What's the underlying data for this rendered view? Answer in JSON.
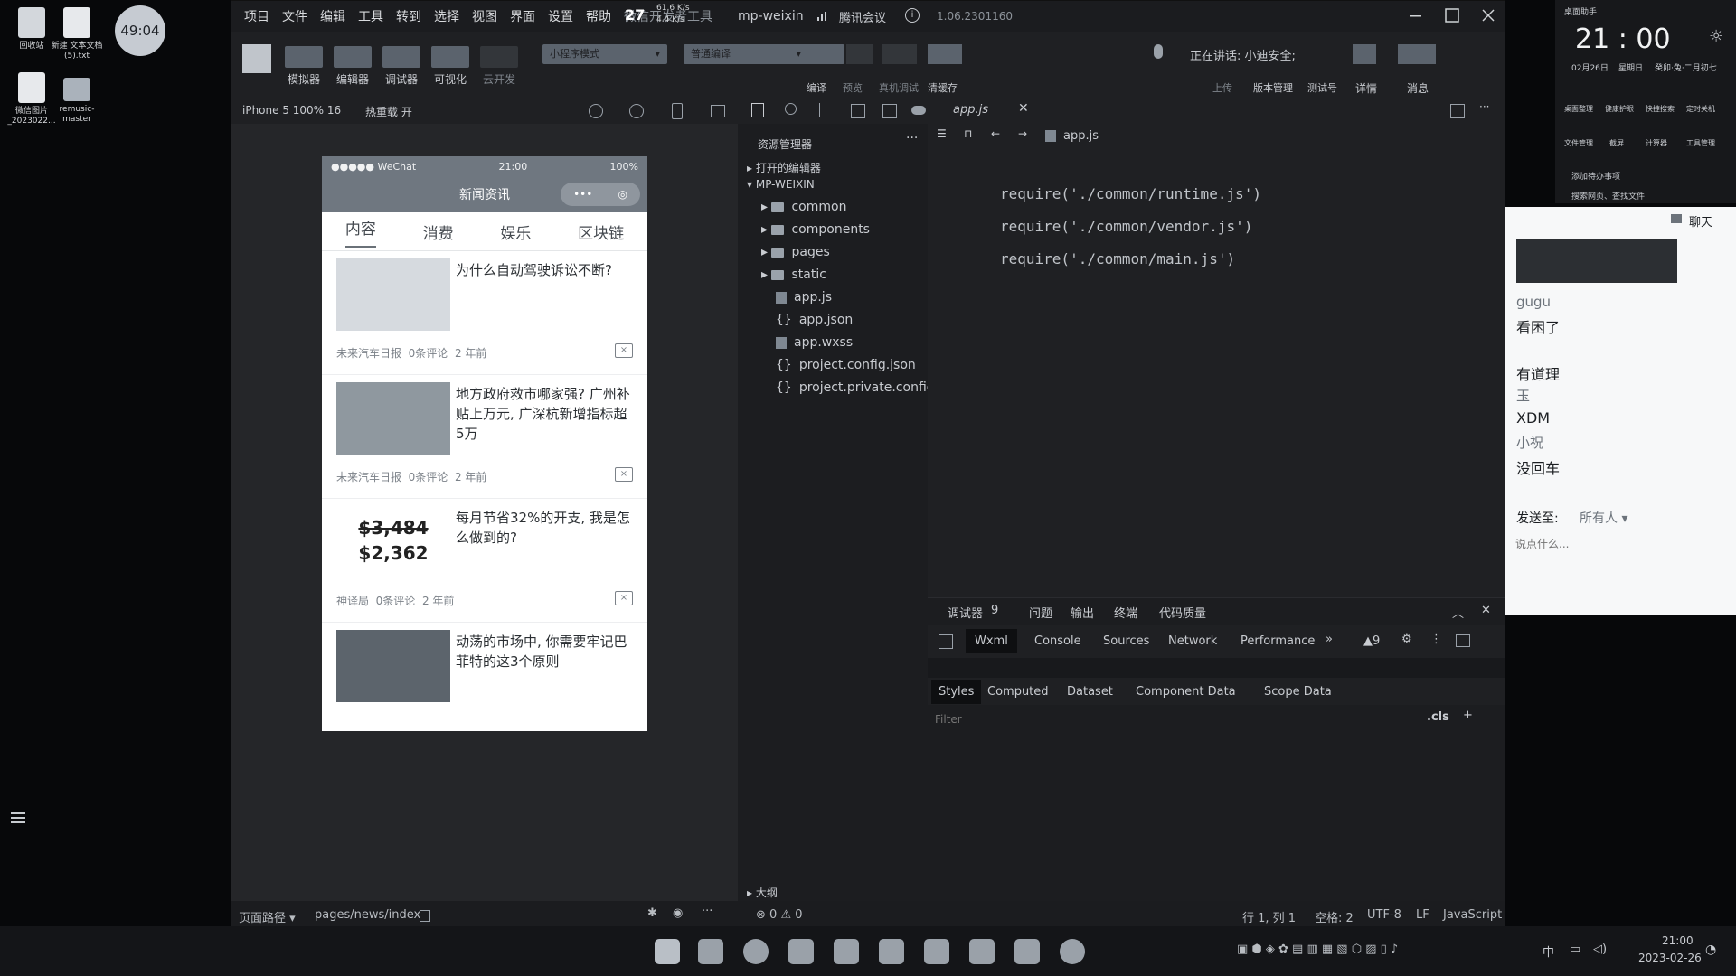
{
  "desktop": {
    "icons": [
      {
        "label": "回收站"
      },
      {
        "label": "新建 文本文档 (5).txt"
      },
      {
        "label": "微信图片_2023022..."
      },
      {
        "label": "remusic-master"
      }
    ],
    "timer": "49:04"
  },
  "ide": {
    "menu": [
      "项目",
      "文件",
      "编辑",
      "工具",
      "转到",
      "选择",
      "视图",
      "界面",
      "设置",
      "帮助",
      "微信开发者工具"
    ],
    "title": "mp-weixin",
    "version": "1.06.2301160",
    "meeting": "腾讯会议",
    "net_speed_up": "61.6 K/s",
    "net_speed_down": "4.4 K/s",
    "net_speed_count": "27",
    "toolbar_buttons": [
      "模拟器",
      "编辑器",
      "调试器",
      "可视化",
      "云开发"
    ],
    "mode_select": "小程序模式",
    "compile_select": "普通编译",
    "toolbar_right": [
      "编译",
      "预览",
      "真机调试",
      "清缓存",
      "上传",
      "版本管理",
      "测试号",
      "详情",
      "消息"
    ],
    "speaking": "正在讲话: 小迪安全;",
    "device": "iPhone 5 100% 16",
    "hotreload": "热重载 开"
  },
  "phone": {
    "carrier": "●●●●● WeChat",
    "time": "21:00",
    "battery": "100%",
    "nav_title": "新闻资讯",
    "tabs": [
      "内容",
      "消费",
      "娱乐",
      "区块链"
    ],
    "news": [
      {
        "title": "为什么自动驾驶诉讼不断?",
        "source": "未来汽车日报",
        "comments": "0条评论",
        "time": "2 年前"
      },
      {
        "title": "地方政府救市哪家强? 广州补贴上万元, 广深杭新增指标超5万",
        "source": "未来汽车日报",
        "comments": "0条评论",
        "time": "2 年前"
      },
      {
        "title": "每月节省32%的开支, 我是怎么做到的?",
        "source": "神译局",
        "comments": "0条评论",
        "time": "2 年前",
        "price_old": "$3,484",
        "price_new": "$2,362"
      },
      {
        "title": "动荡的市场中, 你需要牢记巴菲特的这3个原则",
        "source": "",
        "comments": "",
        "time": ""
      }
    ]
  },
  "explorer": {
    "header": "资源管理器",
    "open_editors": "打开的编辑器",
    "project": "MP-WEIXIN",
    "folders": [
      "common",
      "components",
      "pages",
      "static"
    ],
    "files": [
      "app.js",
      "app.json",
      "app.wxss",
      "project.config.json",
      "project.private.config.js..."
    ],
    "outline": "大纲"
  },
  "editor": {
    "tab": "app.js",
    "breadcrumb": "app.js",
    "lines": [
      "require('./common/runtime.js')",
      "require('./common/vendor.js')",
      "require('./common/main.js')"
    ]
  },
  "debugger": {
    "tabs": [
      "调试器",
      "9",
      "问题",
      "输出",
      "终端",
      "代码质量"
    ],
    "panels": [
      "Wxml",
      "Console",
      "Sources",
      "Network",
      "Performance"
    ],
    "warn_count": "9",
    "style_tabs": [
      "Styles",
      "Computed",
      "Dataset",
      "Component Data",
      "Scope Data"
    ],
    "filter_placeholder": "Filter",
    "cls": ".cls"
  },
  "statusbar": {
    "path_label": "页面路径",
    "path": "pages/news/index",
    "errors": "0",
    "warnings": "0",
    "cursor": "行 1, 列 1",
    "spaces": "空格: 2",
    "encoding": "UTF-8",
    "eol": "LF",
    "language": "JavaScript"
  },
  "widget": {
    "title": "桌面助手",
    "clock": "21 : 00",
    "date": "02月26日",
    "weekday": "星期日",
    "lunar": "癸卯·兔·二月初七",
    "actions": [
      "桌面整理",
      "健康护眼",
      "快捷搜索",
      "定时关机",
      "文件管理",
      "截屏",
      "计算器",
      "工具管理"
    ],
    "todo": "添加待办事项",
    "search": "搜索网页、查找文件"
  },
  "chat": {
    "header": "聊天",
    "messages": [
      {
        "name": "gugu",
        "text": "看困了"
      },
      {
        "name": "",
        "text": "有道理"
      },
      {
        "name": "玉",
        "text": "XDM"
      },
      {
        "name": "小祝",
        "text": "没回车"
      }
    ],
    "send_to_label": "发送至:",
    "send_to_value": "所有人",
    "input_placeholder": "说点什么..."
  },
  "taskbar": {
    "time": "21:00",
    "date": "2023-02-26",
    "ime": "中"
  }
}
